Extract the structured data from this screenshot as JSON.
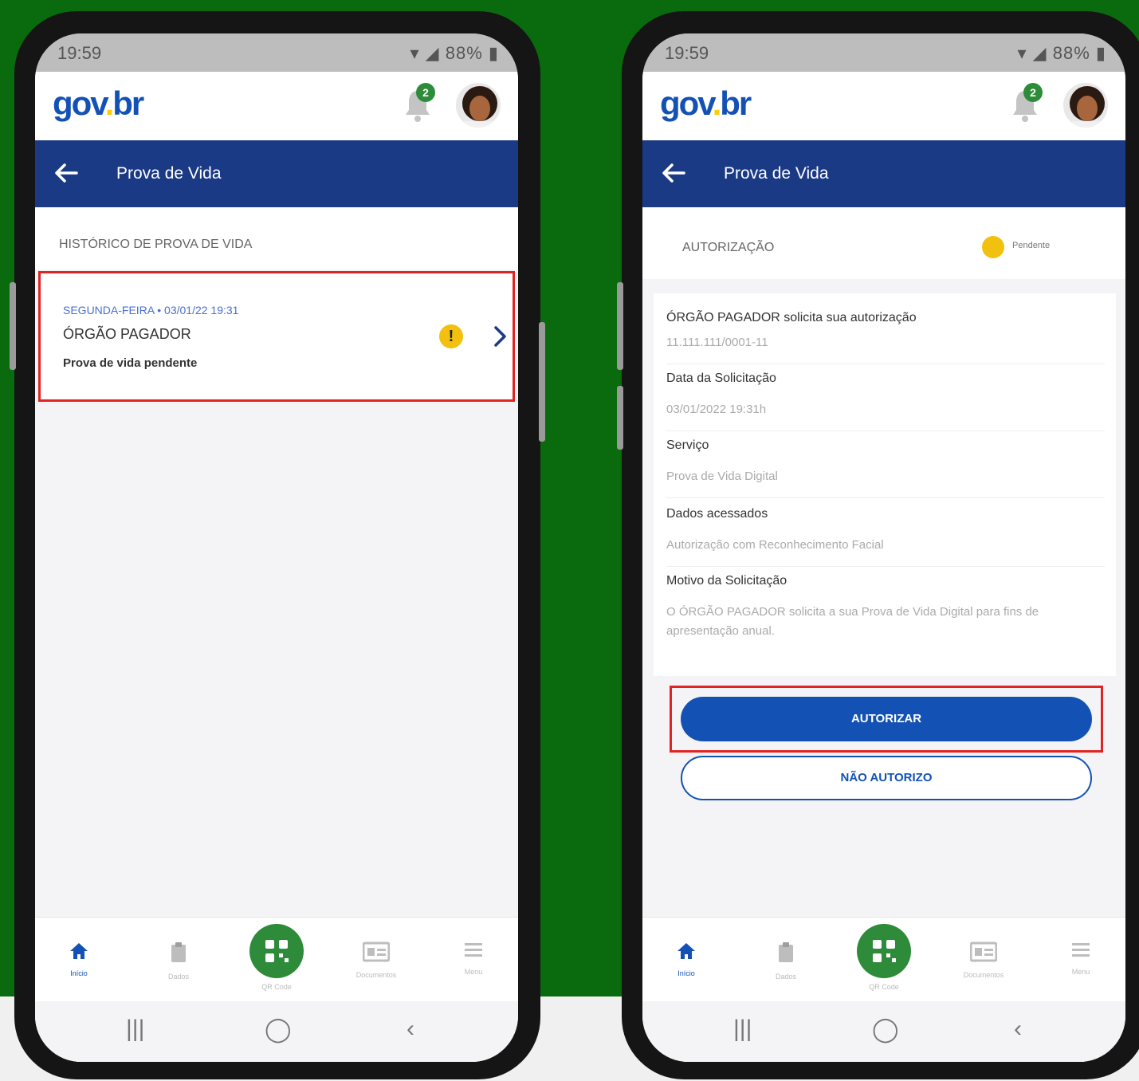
{
  "left_phone": {
    "status": {
      "time": "19:59",
      "battery": "88%"
    },
    "app": {
      "logo_parts": [
        "gov",
        ".",
        "br"
      ],
      "notifications": "2"
    },
    "header": {
      "title": "Prova de Vida"
    },
    "history": {
      "title": "HISTÓRICO DE PROVA DE VIDA",
      "card": {
        "date": "SEGUNDA-FEIRA • 03/01/22 19:31",
        "org": "ÓRGÃO PAGADOR",
        "status": "Prova de vida pendente"
      }
    },
    "nav": {
      "items": [
        "Início",
        "Dados",
        "QR Code",
        "Documentos",
        "Menu"
      ]
    }
  },
  "right_phone": {
    "status": {
      "time": "19:59",
      "battery": "88%"
    },
    "app": {
      "logo_parts": [
        "gov",
        ".",
        "br"
      ],
      "notifications": "2"
    },
    "header": {
      "title": "Prova de Vida"
    },
    "authorization": {
      "title": "AUTORIZAÇÃO",
      "status": "Pendente"
    },
    "details": {
      "request_title": "ÓRGÃO PAGADOR solicita sua autorização",
      "request_id": "11.111.111/0001-11",
      "date_label": "Data da Solicitação",
      "date_value": "03/01/2022 19:31h",
      "service_label": "Serviço",
      "service_value": "Prova de Vida Digital",
      "data_label": "Dados acessados",
      "data_value": "Autorização com Reconhecimento Facial",
      "reason_label": "Motivo da Solicitação",
      "reason_value": "O ÓRGÃO PAGADOR solicita a sua Prova de Vida Digital para fins de apresentação anual."
    },
    "buttons": {
      "authorize": "AUTORIZAR",
      "deny": "NÃO AUTORIZO"
    },
    "nav": {
      "items": [
        "Início",
        "Dados",
        "QR Code",
        "Documentos",
        "Menu"
      ]
    }
  },
  "colors": {
    "green_bg": "#0a6b0e",
    "gov_blue": "#1351b4",
    "header_blue": "#1a3a85",
    "highlight_red": "#e02424",
    "pending_yellow": "#f2c00f"
  }
}
